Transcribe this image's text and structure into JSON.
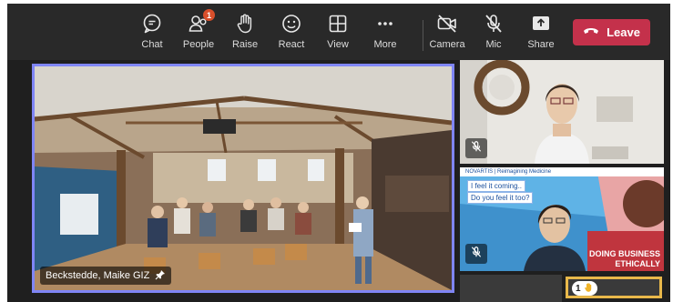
{
  "toolbar": {
    "chat": {
      "label": "Chat",
      "icon": "chat-icon"
    },
    "people": {
      "label": "People",
      "icon": "people-icon",
      "badge": "1"
    },
    "raise": {
      "label": "Raise",
      "icon": "hand-icon"
    },
    "react": {
      "label": "React",
      "icon": "smile-icon"
    },
    "view": {
      "label": "View",
      "icon": "grid-icon"
    },
    "more": {
      "label": "More",
      "icon": "ellipsis-icon"
    },
    "camera": {
      "label": "Camera",
      "icon": "camera-off-icon"
    },
    "mic": {
      "label": "Mic",
      "icon": "mic-off-icon"
    },
    "share": {
      "label": "Share",
      "icon": "share-icon"
    },
    "leave": {
      "label": "Leave",
      "icon": "phone-hangup-icon"
    }
  },
  "main_video": {
    "participant_name": "Beckstedde, Maike GIZ",
    "pinned_icon": "pin-icon"
  },
  "side_videos": [
    {
      "muted_icon": "mic-off-icon"
    },
    {
      "muted_icon": "mic-off-icon",
      "slide_header": "NOVARTIS | Reimagining Medicine",
      "slide_line_1": "I feel it coming..",
      "slide_line_2": "Do you feel it too?",
      "slide_banner_1": "DOING BUSINESS",
      "slide_banner_2": "ETHICALLY"
    }
  ],
  "raised_hands": {
    "count": "1",
    "icon": "raised-hand-icon"
  },
  "colors": {
    "leave": "#c4314b",
    "active_speaker": "#7f85f5",
    "raise_highlight": "#e8b84a",
    "badge": "#d94f2b"
  }
}
